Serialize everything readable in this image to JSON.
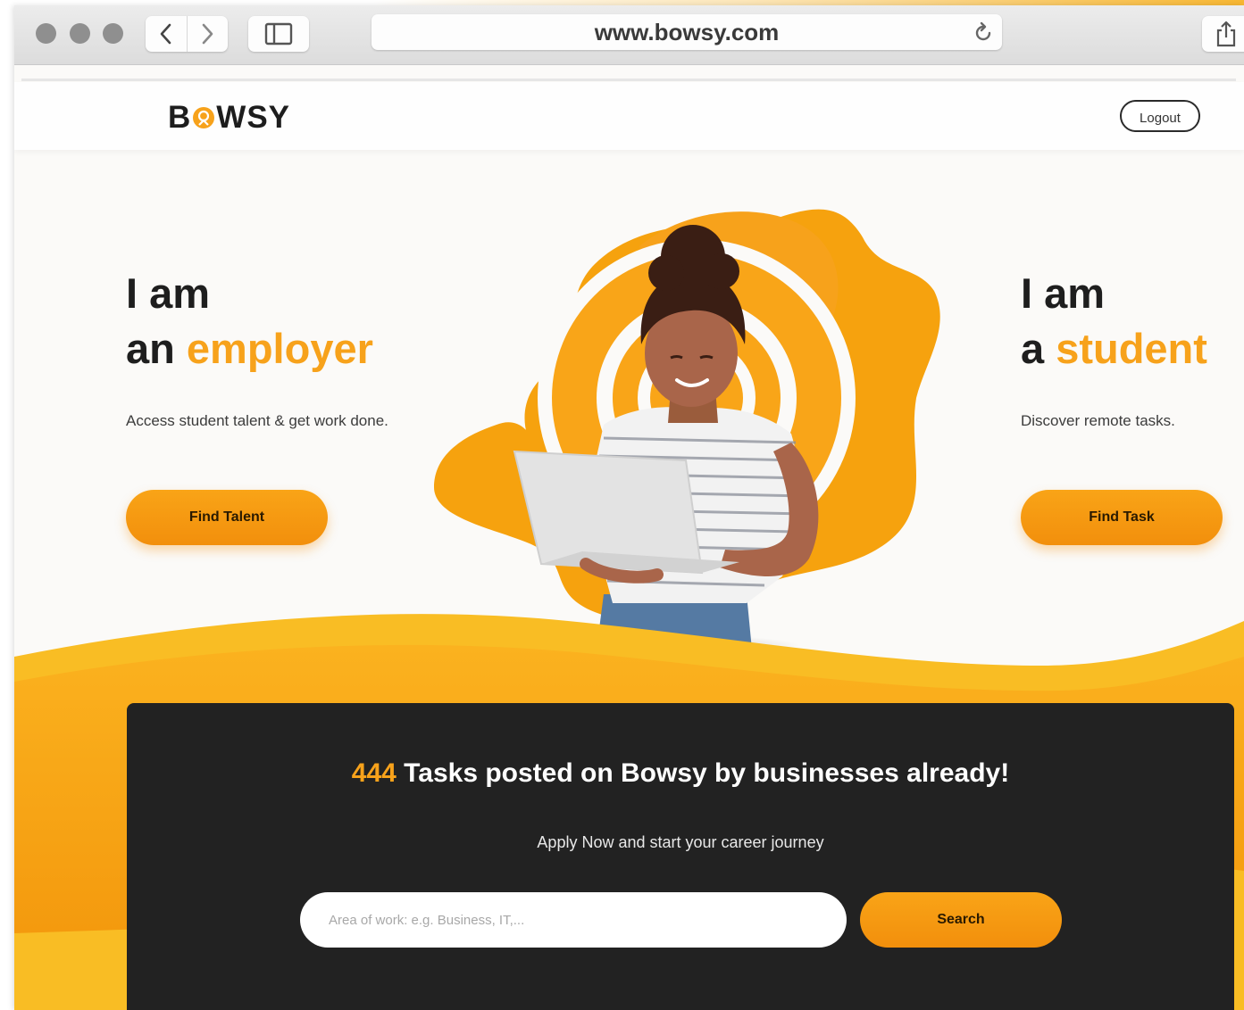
{
  "browser": {
    "url": "www.bowsy.com"
  },
  "header": {
    "logo_prefix": "B",
    "logo_suffix": "WSY",
    "logout_label": "Logout"
  },
  "employer": {
    "line1": "I am",
    "line2_prefix": "an ",
    "line2_accent": "employer",
    "description": "Access student talent & get work done.",
    "button_label": "Find Talent"
  },
  "student": {
    "line1": "I am",
    "line2_prefix": "a ",
    "line2_accent": "student",
    "description": "Discover remote tasks.",
    "button_label": "Find Task"
  },
  "tasks_panel": {
    "count": "444",
    "title_rest": " Tasks posted on Bowsy by businesses already!",
    "subtitle": "Apply Now and start your career journey",
    "search_placeholder": "Area of work: e.g. Business, IT,...",
    "search_button": "Search"
  },
  "colors": {
    "accent": "#f7a21b",
    "dark_panel": "#222222"
  }
}
